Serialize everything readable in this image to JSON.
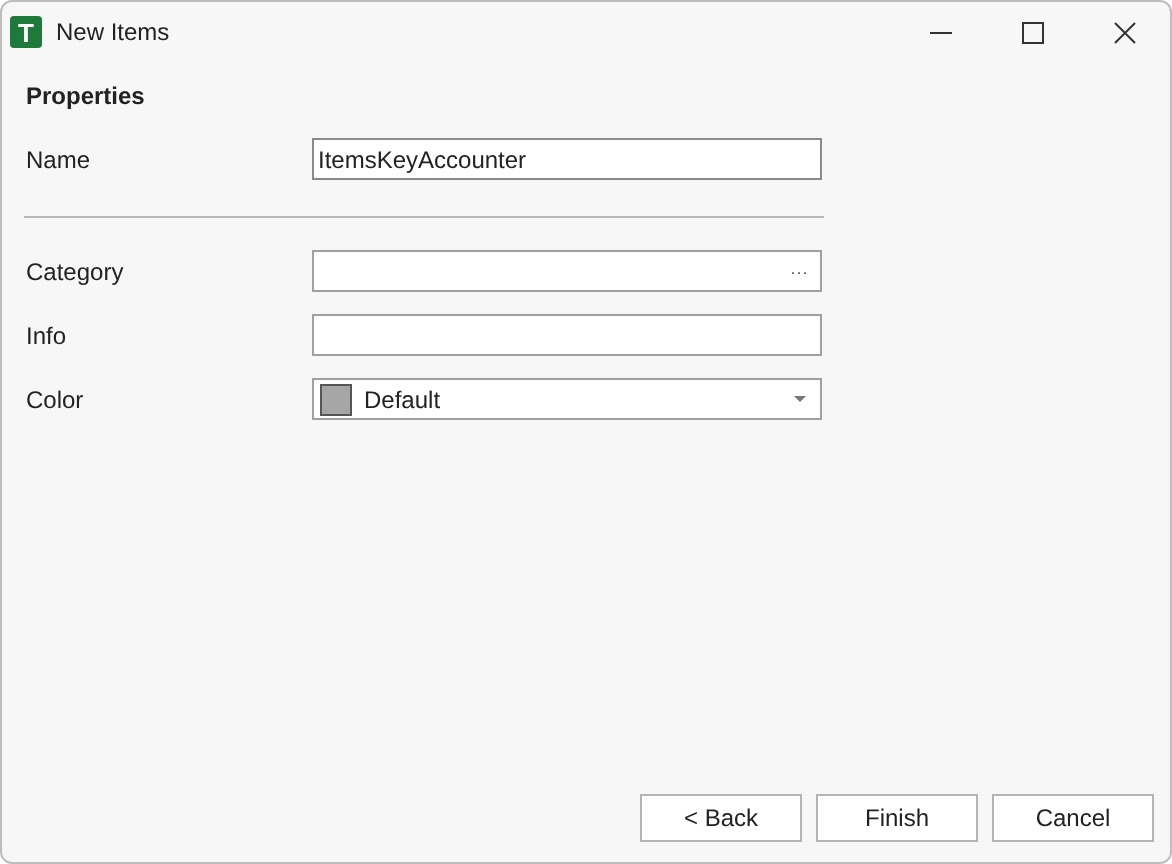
{
  "window": {
    "title": "New Items",
    "app_icon_letter": "T"
  },
  "section_title": "Properties",
  "name_field": {
    "label": "Name",
    "value": "ItemsKeyAccounter"
  },
  "fields": [
    {
      "kind": "browse",
      "label": "Category",
      "button": "···"
    },
    {
      "kind": "text",
      "label": "Info"
    },
    {
      "kind": "color",
      "label": "Color",
      "value": "Default",
      "color": "#a6a6a6"
    }
  ],
  "buttons": [
    "< Back",
    "Finish",
    "Cancel"
  ]
}
